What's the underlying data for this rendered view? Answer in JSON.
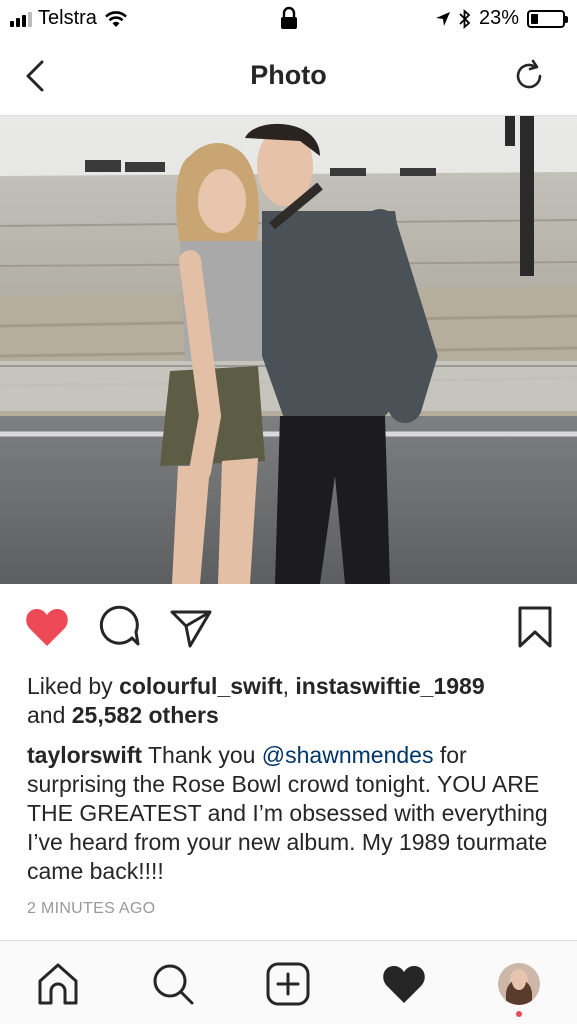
{
  "status_bar": {
    "carrier": "Telstra",
    "battery_text": "23%",
    "battery_level": 0.23,
    "icons": [
      "signal-icon",
      "wifi-icon",
      "lock-icon",
      "location-icon",
      "bluetooth-icon",
      "battery-icon"
    ]
  },
  "nav": {
    "title": "Photo",
    "back_icon": "chevron-left-icon",
    "refresh_icon": "refresh-icon"
  },
  "post": {
    "actions": {
      "like_icon": "heart-filled-icon",
      "comment_icon": "comment-icon",
      "share_icon": "paper-plane-icon",
      "save_icon": "bookmark-icon",
      "like_color": "#ed4956"
    },
    "likes": {
      "prefix": "Liked by ",
      "user1": "colourful_swift",
      "separator": ", ",
      "user2": "instaswiftie_1989",
      "and_text": "and ",
      "others": "25,582 others"
    },
    "caption": {
      "username": "taylorswift",
      "text_before": " Thank you ",
      "mention": "@shawnmendes",
      "text_after": " for surprising the Rose Bowl crowd tonight. YOU ARE THE GREATEST and I’m obsessed with everything I’ve heard from your new album. My 1989 tourmate came back!!!!"
    },
    "timestamp": "2 MINUTES AGO"
  },
  "tabbar": {
    "items": [
      "home-icon",
      "search-icon",
      "add-post-icon",
      "activity-heart-icon",
      "profile-avatar"
    ],
    "notification_color": "#ed4956"
  }
}
